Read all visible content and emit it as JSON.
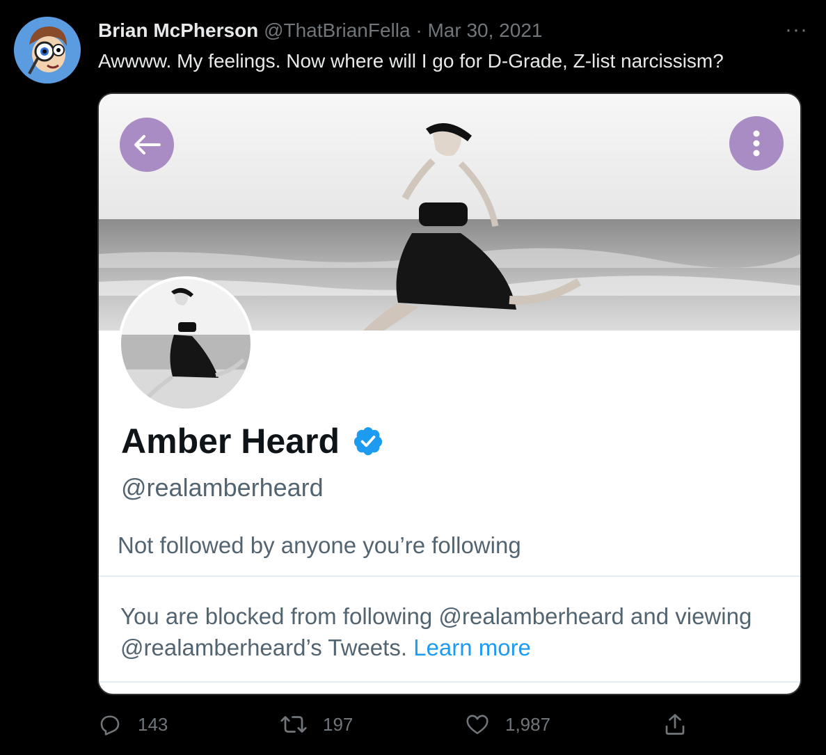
{
  "tweet": {
    "author_name": "Brian McPherson",
    "author_handle": "@ThatBrianFella",
    "separator": " · ",
    "date": "Mar 30, 2021",
    "more_label": "···",
    "text": "Awwww. My feelings. Now where will I go for D-Grade, Z-list narcissism?"
  },
  "card": {
    "profile_name": "Amber Heard",
    "profile_handle": "@realamberheard",
    "follow_note": "Not followed by anyone you’re following",
    "blocked_text": "You are blocked from following @realamberheard and viewing @realamberheard’s Tweets.",
    "learn_more": "Learn more",
    "back_icon": "arrow-left-icon",
    "menu_icon": "vertical-dots-icon",
    "verified_icon": "verified-badge-icon",
    "accent_button_color": "#a98cc4",
    "verified_color": "#1d9bf0"
  },
  "actions": {
    "replies": "143",
    "retweets": "197",
    "likes": "1,987"
  }
}
